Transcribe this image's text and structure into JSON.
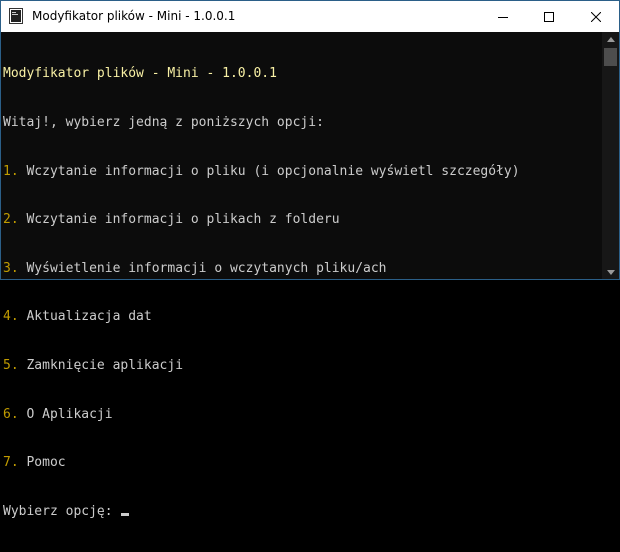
{
  "window": {
    "title": "Modyfikator plików - Mini - 1.0.0.1",
    "icon": "console-app-icon",
    "controls": [
      "minimize-icon",
      "maximize-icon",
      "close-icon"
    ]
  },
  "console": {
    "header": "Modyfikator plików - Mini - 1.0.0.1",
    "welcome": "Witaj!, wybierz jedną z poniższych opcji:",
    "options": [
      {
        "num": "1.",
        "text": " Wczytanie informacji o pliku (i opcjonalnie wyświetl szczegóły)"
      },
      {
        "num": "2.",
        "text": " Wczytanie informacji o plikach z folderu"
      },
      {
        "num": "3.",
        "text": " Wyświetlenie informacji o wczytanych pliku/ach"
      },
      {
        "num": "4.",
        "text": " Aktualizacja dat"
      },
      {
        "num": "5.",
        "text": " Zamknięcie aplikacji"
      },
      {
        "num": "6.",
        "text": " O Aplikacji"
      },
      {
        "num": "7.",
        "text": " Pomoc"
      }
    ],
    "prompt": "Wybierz opcję: "
  },
  "colors": {
    "header": "#f9f1a5",
    "option_number": "#c19c00",
    "text": "#cccccc",
    "background": "#0c0c0c"
  }
}
